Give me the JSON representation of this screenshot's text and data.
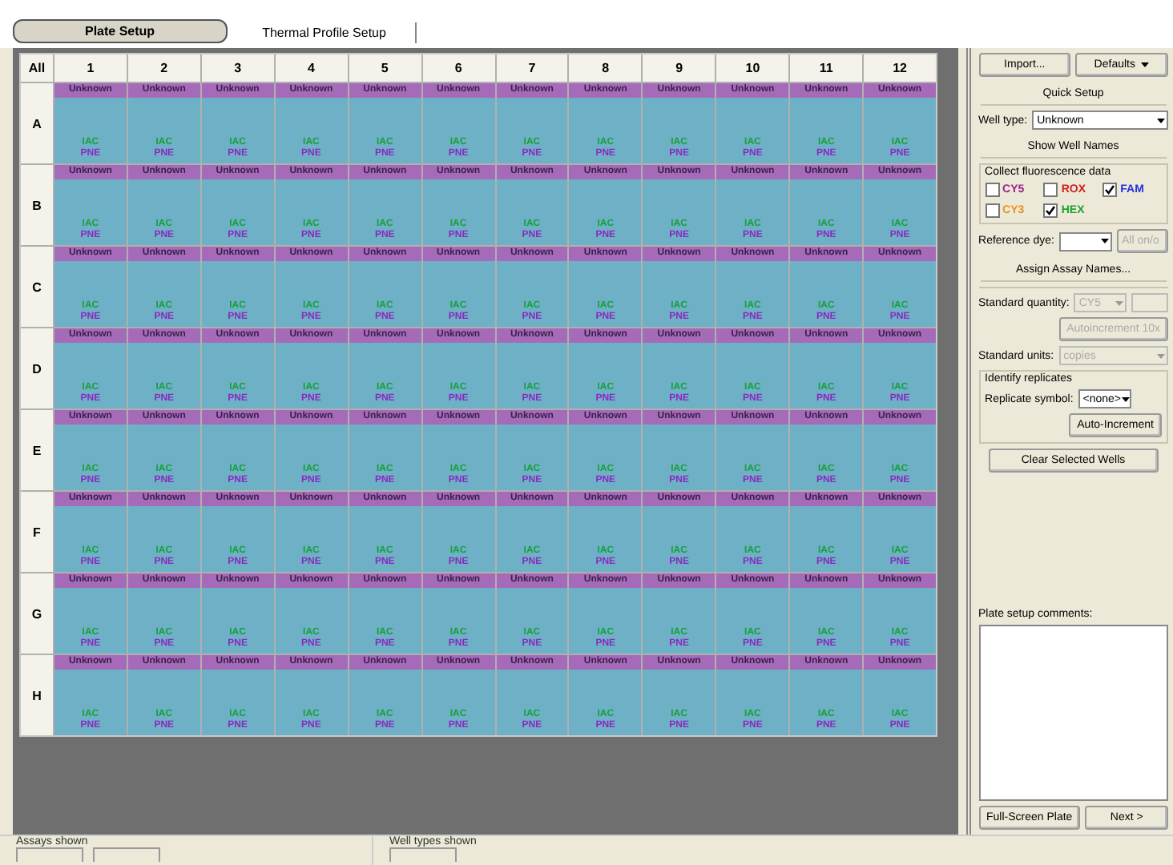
{
  "tabs": [
    {
      "label": "Plate Setup",
      "selected": true
    },
    {
      "label": "Thermal Profile Setup",
      "selected": false
    }
  ],
  "plate": {
    "corner": "All",
    "columns": [
      "1",
      "2",
      "3",
      "4",
      "5",
      "6",
      "7",
      "8",
      "9",
      "10",
      "11",
      "12"
    ],
    "rows": [
      {
        "label": "A",
        "wells": [
          {
            "type": "Unknown",
            "assays": [
              {
                "name": "IAC",
                "color": "#18a03a"
              },
              {
                "name": "PNE",
                "color": "#8a28c0"
              }
            ]
          },
          {
            "type": "Unknown",
            "assays": [
              {
                "name": "IAC",
                "color": "#18a03a"
              },
              {
                "name": "PNE",
                "color": "#8a28c0"
              }
            ]
          },
          {
            "type": "Unknown",
            "assays": [
              {
                "name": "IAC",
                "color": "#18a03a"
              },
              {
                "name": "PNE",
                "color": "#8a28c0"
              }
            ]
          },
          {
            "type": "Unknown",
            "assays": [
              {
                "name": "IAC",
                "color": "#18a03a"
              },
              {
                "name": "PNE",
                "color": "#8a28c0"
              }
            ]
          },
          {
            "type": "Unknown",
            "assays": [
              {
                "name": "IAC",
                "color": "#18a03a"
              },
              {
                "name": "PNE",
                "color": "#8a28c0"
              }
            ]
          },
          {
            "type": "Unknown",
            "assays": [
              {
                "name": "IAC",
                "color": "#18a03a"
              },
              {
                "name": "PNE",
                "color": "#8a28c0"
              }
            ]
          },
          {
            "type": "Unknown",
            "assays": [
              {
                "name": "IAC",
                "color": "#18a03a"
              },
              {
                "name": "PNE",
                "color": "#8a28c0"
              }
            ]
          },
          {
            "type": "Unknown",
            "assays": [
              {
                "name": "IAC",
                "color": "#18a03a"
              },
              {
                "name": "PNE",
                "color": "#8a28c0"
              }
            ]
          },
          {
            "type": "Unknown",
            "assays": [
              {
                "name": "IAC",
                "color": "#18a03a"
              },
              {
                "name": "PNE",
                "color": "#8a28c0"
              }
            ]
          },
          {
            "type": "Unknown",
            "assays": [
              {
                "name": "IAC",
                "color": "#18a03a"
              },
              {
                "name": "PNE",
                "color": "#8a28c0"
              }
            ]
          },
          {
            "type": "Unknown",
            "assays": [
              {
                "name": "IAC",
                "color": "#18a03a"
              },
              {
                "name": "PNE",
                "color": "#8a28c0"
              }
            ]
          },
          {
            "type": "Unknown",
            "assays": [
              {
                "name": "IAC",
                "color": "#18a03a"
              },
              {
                "name": "PNE",
                "color": "#8a28c0"
              }
            ]
          }
        ]
      },
      {
        "label": "B",
        "wells": [
          {
            "type": "Unknown",
            "assays": [
              {
                "name": "IAC",
                "color": "#18a03a"
              },
              {
                "name": "PNE",
                "color": "#8a28c0"
              }
            ]
          },
          {
            "type": "Unknown",
            "assays": [
              {
                "name": "IAC",
                "color": "#18a03a"
              },
              {
                "name": "PNE",
                "color": "#8a28c0"
              }
            ]
          },
          {
            "type": "Unknown",
            "assays": [
              {
                "name": "IAC",
                "color": "#18a03a"
              },
              {
                "name": "PNE",
                "color": "#8a28c0"
              }
            ]
          },
          {
            "type": "Unknown",
            "assays": [
              {
                "name": "IAC",
                "color": "#18a03a"
              },
              {
                "name": "PNE",
                "color": "#8a28c0"
              }
            ]
          },
          {
            "type": "Unknown",
            "assays": [
              {
                "name": "IAC",
                "color": "#18a03a"
              },
              {
                "name": "PNE",
                "color": "#8a28c0"
              }
            ]
          },
          {
            "type": "Unknown",
            "assays": [
              {
                "name": "IAC",
                "color": "#18a03a"
              },
              {
                "name": "PNE",
                "color": "#8a28c0"
              }
            ]
          },
          {
            "type": "Unknown",
            "assays": [
              {
                "name": "IAC",
                "color": "#18a03a"
              },
              {
                "name": "PNE",
                "color": "#8a28c0"
              }
            ]
          },
          {
            "type": "Unknown",
            "assays": [
              {
                "name": "IAC",
                "color": "#18a03a"
              },
              {
                "name": "PNE",
                "color": "#8a28c0"
              }
            ]
          },
          {
            "type": "Unknown",
            "assays": [
              {
                "name": "IAC",
                "color": "#18a03a"
              },
              {
                "name": "PNE",
                "color": "#8a28c0"
              }
            ]
          },
          {
            "type": "Unknown",
            "assays": [
              {
                "name": "IAC",
                "color": "#18a03a"
              },
              {
                "name": "PNE",
                "color": "#8a28c0"
              }
            ]
          },
          {
            "type": "Unknown",
            "assays": [
              {
                "name": "IAC",
                "color": "#18a03a"
              },
              {
                "name": "PNE",
                "color": "#8a28c0"
              }
            ]
          },
          {
            "type": "Unknown",
            "assays": [
              {
                "name": "IAC",
                "color": "#18a03a"
              },
              {
                "name": "PNE",
                "color": "#8a28c0"
              }
            ]
          }
        ]
      },
      {
        "label": "C",
        "wells": [
          {
            "type": "Unknown",
            "assays": [
              {
                "name": "IAC",
                "color": "#18a03a"
              },
              {
                "name": "PNE",
                "color": "#8a28c0"
              }
            ]
          },
          {
            "type": "Unknown",
            "assays": [
              {
                "name": "IAC",
                "color": "#18a03a"
              },
              {
                "name": "PNE",
                "color": "#8a28c0"
              }
            ]
          },
          {
            "type": "Unknown",
            "assays": [
              {
                "name": "IAC",
                "color": "#18a03a"
              },
              {
                "name": "PNE",
                "color": "#8a28c0"
              }
            ]
          },
          {
            "type": "Unknown",
            "assays": [
              {
                "name": "IAC",
                "color": "#18a03a"
              },
              {
                "name": "PNE",
                "color": "#8a28c0"
              }
            ]
          },
          {
            "type": "Unknown",
            "assays": [
              {
                "name": "IAC",
                "color": "#18a03a"
              },
              {
                "name": "PNE",
                "color": "#8a28c0"
              }
            ]
          },
          {
            "type": "Unknown",
            "assays": [
              {
                "name": "IAC",
                "color": "#18a03a"
              },
              {
                "name": "PNE",
                "color": "#8a28c0"
              }
            ]
          },
          {
            "type": "Unknown",
            "assays": [
              {
                "name": "IAC",
                "color": "#18a03a"
              },
              {
                "name": "PNE",
                "color": "#8a28c0"
              }
            ]
          },
          {
            "type": "Unknown",
            "assays": [
              {
                "name": "IAC",
                "color": "#18a03a"
              },
              {
                "name": "PNE",
                "color": "#8a28c0"
              }
            ]
          },
          {
            "type": "Unknown",
            "assays": [
              {
                "name": "IAC",
                "color": "#18a03a"
              },
              {
                "name": "PNE",
                "color": "#8a28c0"
              }
            ]
          },
          {
            "type": "Unknown",
            "assays": [
              {
                "name": "IAC",
                "color": "#18a03a"
              },
              {
                "name": "PNE",
                "color": "#8a28c0"
              }
            ]
          },
          {
            "type": "Unknown",
            "assays": [
              {
                "name": "IAC",
                "color": "#18a03a"
              },
              {
                "name": "PNE",
                "color": "#8a28c0"
              }
            ]
          },
          {
            "type": "Unknown",
            "assays": [
              {
                "name": "IAC",
                "color": "#18a03a"
              },
              {
                "name": "PNE",
                "color": "#8a28c0"
              }
            ]
          }
        ]
      },
      {
        "label": "D",
        "wells": [
          {
            "type": "Unknown",
            "assays": [
              {
                "name": "IAC",
                "color": "#18a03a"
              },
              {
                "name": "PNE",
                "color": "#8a28c0"
              }
            ]
          },
          {
            "type": "Unknown",
            "assays": [
              {
                "name": "IAC",
                "color": "#18a03a"
              },
              {
                "name": "PNE",
                "color": "#8a28c0"
              }
            ]
          },
          {
            "type": "Unknown",
            "assays": [
              {
                "name": "IAC",
                "color": "#18a03a"
              },
              {
                "name": "PNE",
                "color": "#8a28c0"
              }
            ]
          },
          {
            "type": "Unknown",
            "assays": [
              {
                "name": "IAC",
                "color": "#18a03a"
              },
              {
                "name": "PNE",
                "color": "#8a28c0"
              }
            ]
          },
          {
            "type": "Unknown",
            "assays": [
              {
                "name": "IAC",
                "color": "#18a03a"
              },
              {
                "name": "PNE",
                "color": "#8a28c0"
              }
            ]
          },
          {
            "type": "Unknown",
            "assays": [
              {
                "name": "IAC",
                "color": "#18a03a"
              },
              {
                "name": "PNE",
                "color": "#8a28c0"
              }
            ]
          },
          {
            "type": "Unknown",
            "assays": [
              {
                "name": "IAC",
                "color": "#18a03a"
              },
              {
                "name": "PNE",
                "color": "#8a28c0"
              }
            ]
          },
          {
            "type": "Unknown",
            "assays": [
              {
                "name": "IAC",
                "color": "#18a03a"
              },
              {
                "name": "PNE",
                "color": "#8a28c0"
              }
            ]
          },
          {
            "type": "Unknown",
            "assays": [
              {
                "name": "IAC",
                "color": "#18a03a"
              },
              {
                "name": "PNE",
                "color": "#8a28c0"
              }
            ]
          },
          {
            "type": "Unknown",
            "assays": [
              {
                "name": "IAC",
                "color": "#18a03a"
              },
              {
                "name": "PNE",
                "color": "#8a28c0"
              }
            ]
          },
          {
            "type": "Unknown",
            "assays": [
              {
                "name": "IAC",
                "color": "#18a03a"
              },
              {
                "name": "PNE",
                "color": "#8a28c0"
              }
            ]
          },
          {
            "type": "Unknown",
            "assays": [
              {
                "name": "IAC",
                "color": "#18a03a"
              },
              {
                "name": "PNE",
                "color": "#8a28c0"
              }
            ]
          }
        ]
      },
      {
        "label": "E",
        "wells": [
          {
            "type": "Unknown",
            "assays": [
              {
                "name": "IAC",
                "color": "#18a03a"
              },
              {
                "name": "PNE",
                "color": "#8a28c0"
              }
            ]
          },
          {
            "type": "Unknown",
            "assays": [
              {
                "name": "IAC",
                "color": "#18a03a"
              },
              {
                "name": "PNE",
                "color": "#8a28c0"
              }
            ]
          },
          {
            "type": "Unknown",
            "assays": [
              {
                "name": "IAC",
                "color": "#18a03a"
              },
              {
                "name": "PNE",
                "color": "#8a28c0"
              }
            ]
          },
          {
            "type": "Unknown",
            "assays": [
              {
                "name": "IAC",
                "color": "#18a03a"
              },
              {
                "name": "PNE",
                "color": "#8a28c0"
              }
            ]
          },
          {
            "type": "Unknown",
            "assays": [
              {
                "name": "IAC",
                "color": "#18a03a"
              },
              {
                "name": "PNE",
                "color": "#8a28c0"
              }
            ]
          },
          {
            "type": "Unknown",
            "assays": [
              {
                "name": "IAC",
                "color": "#18a03a"
              },
              {
                "name": "PNE",
                "color": "#8a28c0"
              }
            ]
          },
          {
            "type": "Unknown",
            "assays": [
              {
                "name": "IAC",
                "color": "#18a03a"
              },
              {
                "name": "PNE",
                "color": "#8a28c0"
              }
            ]
          },
          {
            "type": "Unknown",
            "assays": [
              {
                "name": "IAC",
                "color": "#18a03a"
              },
              {
                "name": "PNE",
                "color": "#8a28c0"
              }
            ]
          },
          {
            "type": "Unknown",
            "assays": [
              {
                "name": "IAC",
                "color": "#18a03a"
              },
              {
                "name": "PNE",
                "color": "#8a28c0"
              }
            ]
          },
          {
            "type": "Unknown",
            "assays": [
              {
                "name": "IAC",
                "color": "#18a03a"
              },
              {
                "name": "PNE",
                "color": "#8a28c0"
              }
            ]
          },
          {
            "type": "Unknown",
            "assays": [
              {
                "name": "IAC",
                "color": "#18a03a"
              },
              {
                "name": "PNE",
                "color": "#8a28c0"
              }
            ]
          },
          {
            "type": "Unknown",
            "assays": [
              {
                "name": "IAC",
                "color": "#18a03a"
              },
              {
                "name": "PNE",
                "color": "#8a28c0"
              }
            ]
          }
        ]
      },
      {
        "label": "F",
        "wells": [
          {
            "type": "Unknown",
            "assays": [
              {
                "name": "IAC",
                "color": "#18a03a"
              },
              {
                "name": "PNE",
                "color": "#8a28c0"
              }
            ]
          },
          {
            "type": "Unknown",
            "assays": [
              {
                "name": "IAC",
                "color": "#18a03a"
              },
              {
                "name": "PNE",
                "color": "#8a28c0"
              }
            ]
          },
          {
            "type": "Unknown",
            "assays": [
              {
                "name": "IAC",
                "color": "#18a03a"
              },
              {
                "name": "PNE",
                "color": "#8a28c0"
              }
            ]
          },
          {
            "type": "Unknown",
            "assays": [
              {
                "name": "IAC",
                "color": "#18a03a"
              },
              {
                "name": "PNE",
                "color": "#8a28c0"
              }
            ]
          },
          {
            "type": "Unknown",
            "assays": [
              {
                "name": "IAC",
                "color": "#18a03a"
              },
              {
                "name": "PNE",
                "color": "#8a28c0"
              }
            ]
          },
          {
            "type": "Unknown",
            "assays": [
              {
                "name": "IAC",
                "color": "#18a03a"
              },
              {
                "name": "PNE",
                "color": "#8a28c0"
              }
            ]
          },
          {
            "type": "Unknown",
            "assays": [
              {
                "name": "IAC",
                "color": "#18a03a"
              },
              {
                "name": "PNE",
                "color": "#8a28c0"
              }
            ]
          },
          {
            "type": "Unknown",
            "assays": [
              {
                "name": "IAC",
                "color": "#18a03a"
              },
              {
                "name": "PNE",
                "color": "#8a28c0"
              }
            ]
          },
          {
            "type": "Unknown",
            "assays": [
              {
                "name": "IAC",
                "color": "#18a03a"
              },
              {
                "name": "PNE",
                "color": "#8a28c0"
              }
            ]
          },
          {
            "type": "Unknown",
            "assays": [
              {
                "name": "IAC",
                "color": "#18a03a"
              },
              {
                "name": "PNE",
                "color": "#8a28c0"
              }
            ]
          },
          {
            "type": "Unknown",
            "assays": [
              {
                "name": "IAC",
                "color": "#18a03a"
              },
              {
                "name": "PNE",
                "color": "#8a28c0"
              }
            ]
          },
          {
            "type": "Unknown",
            "assays": [
              {
                "name": "IAC",
                "color": "#18a03a"
              },
              {
                "name": "PNE",
                "color": "#8a28c0"
              }
            ]
          }
        ]
      },
      {
        "label": "G",
        "wells": [
          {
            "type": "Unknown",
            "assays": [
              {
                "name": "IAC",
                "color": "#18a03a"
              },
              {
                "name": "PNE",
                "color": "#8a28c0"
              }
            ]
          },
          {
            "type": "Unknown",
            "assays": [
              {
                "name": "IAC",
                "color": "#18a03a"
              },
              {
                "name": "PNE",
                "color": "#8a28c0"
              }
            ]
          },
          {
            "type": "Unknown",
            "assays": [
              {
                "name": "IAC",
                "color": "#18a03a"
              },
              {
                "name": "PNE",
                "color": "#8a28c0"
              }
            ]
          },
          {
            "type": "Unknown",
            "assays": [
              {
                "name": "IAC",
                "color": "#18a03a"
              },
              {
                "name": "PNE",
                "color": "#8a28c0"
              }
            ]
          },
          {
            "type": "Unknown",
            "assays": [
              {
                "name": "IAC",
                "color": "#18a03a"
              },
              {
                "name": "PNE",
                "color": "#8a28c0"
              }
            ]
          },
          {
            "type": "Unknown",
            "assays": [
              {
                "name": "IAC",
                "color": "#18a03a"
              },
              {
                "name": "PNE",
                "color": "#8a28c0"
              }
            ]
          },
          {
            "type": "Unknown",
            "assays": [
              {
                "name": "IAC",
                "color": "#18a03a"
              },
              {
                "name": "PNE",
                "color": "#8a28c0"
              }
            ]
          },
          {
            "type": "Unknown",
            "assays": [
              {
                "name": "IAC",
                "color": "#18a03a"
              },
              {
                "name": "PNE",
                "color": "#8a28c0"
              }
            ]
          },
          {
            "type": "Unknown",
            "assays": [
              {
                "name": "IAC",
                "color": "#18a03a"
              },
              {
                "name": "PNE",
                "color": "#8a28c0"
              }
            ]
          },
          {
            "type": "Unknown",
            "assays": [
              {
                "name": "IAC",
                "color": "#18a03a"
              },
              {
                "name": "PNE",
                "color": "#8a28c0"
              }
            ]
          },
          {
            "type": "Unknown",
            "assays": [
              {
                "name": "IAC",
                "color": "#18a03a"
              },
              {
                "name": "PNE",
                "color": "#8a28c0"
              }
            ]
          },
          {
            "type": "Unknown",
            "assays": [
              {
                "name": "IAC",
                "color": "#18a03a"
              },
              {
                "name": "PNE",
                "color": "#8a28c0"
              }
            ]
          }
        ]
      },
      {
        "label": "H",
        "wells": [
          {
            "type": "Unknown",
            "assays": [
              {
                "name": "IAC",
                "color": "#18a03a"
              },
              {
                "name": "PNE",
                "color": "#8a28c0"
              }
            ]
          },
          {
            "type": "Unknown",
            "assays": [
              {
                "name": "IAC",
                "color": "#18a03a"
              },
              {
                "name": "PNE",
                "color": "#8a28c0"
              }
            ]
          },
          {
            "type": "Unknown",
            "assays": [
              {
                "name": "IAC",
                "color": "#18a03a"
              },
              {
                "name": "PNE",
                "color": "#8a28c0"
              }
            ]
          },
          {
            "type": "Unknown",
            "assays": [
              {
                "name": "IAC",
                "color": "#18a03a"
              },
              {
                "name": "PNE",
                "color": "#8a28c0"
              }
            ]
          },
          {
            "type": "Unknown",
            "assays": [
              {
                "name": "IAC",
                "color": "#18a03a"
              },
              {
                "name": "PNE",
                "color": "#8a28c0"
              }
            ]
          },
          {
            "type": "Unknown",
            "assays": [
              {
                "name": "IAC",
                "color": "#18a03a"
              },
              {
                "name": "PNE",
                "color": "#8a28c0"
              }
            ]
          },
          {
            "type": "Unknown",
            "assays": [
              {
                "name": "IAC",
                "color": "#18a03a"
              },
              {
                "name": "PNE",
                "color": "#8a28c0"
              }
            ]
          },
          {
            "type": "Unknown",
            "assays": [
              {
                "name": "IAC",
                "color": "#18a03a"
              },
              {
                "name": "PNE",
                "color": "#8a28c0"
              }
            ]
          },
          {
            "type": "Unknown",
            "assays": [
              {
                "name": "IAC",
                "color": "#18a03a"
              },
              {
                "name": "PNE",
                "color": "#8a28c0"
              }
            ]
          },
          {
            "type": "Unknown",
            "assays": [
              {
                "name": "IAC",
                "color": "#18a03a"
              },
              {
                "name": "PNE",
                "color": "#8a28c0"
              }
            ]
          },
          {
            "type": "Unknown",
            "assays": [
              {
                "name": "IAC",
                "color": "#18a03a"
              },
              {
                "name": "PNE",
                "color": "#8a28c0"
              }
            ]
          },
          {
            "type": "Unknown",
            "assays": [
              {
                "name": "IAC",
                "color": "#18a03a"
              },
              {
                "name": "PNE",
                "color": "#8a28c0"
              }
            ]
          }
        ]
      }
    ]
  },
  "panel": {
    "import_button": "Import...",
    "defaults_button": "Defaults",
    "quick_setup_button": "Quick Setup",
    "well_type": {
      "label": "Well type:",
      "value": "Unknown"
    },
    "show_well_names_button": "Show Well Names",
    "fluorescence": {
      "title": "Collect fluorescence data",
      "dyes": [
        {
          "label": "CY5",
          "color": "#a0208a",
          "checked": false
        },
        {
          "label": "ROX",
          "color": "#d02020",
          "checked": false
        },
        {
          "label": "FAM",
          "color": "#2030e0",
          "checked": true
        },
        {
          "label": "CY3",
          "color": "#f09020",
          "checked": false
        },
        {
          "label": "HEX",
          "color": "#20a030",
          "checked": true
        }
      ]
    },
    "reference_dye": {
      "label": "Reference dye:",
      "all_button": "All on/o",
      "all_disabled": true
    },
    "assign_button": "Assign Assay Names...",
    "standard_quantity": {
      "label": "Standard quantity:",
      "dye": "CY5",
      "disabled": true
    },
    "autoincrement_button": "Autoincrement 10x",
    "standard_units": {
      "label": "Standard units:",
      "value": "copies",
      "disabled": true
    },
    "replicates": {
      "title": "Identify replicates",
      "label": "Replicate symbol:",
      "value": "<none>",
      "auto_button": "Auto-Increment"
    },
    "clear_button": "Clear Selected Wells",
    "comments_label": "Plate setup comments:",
    "full_screen_button": "Full-Screen Plate",
    "next_button": "Next >"
  },
  "footer": {
    "assays_label": "Assays shown",
    "well_types_label": "Well types shown"
  }
}
